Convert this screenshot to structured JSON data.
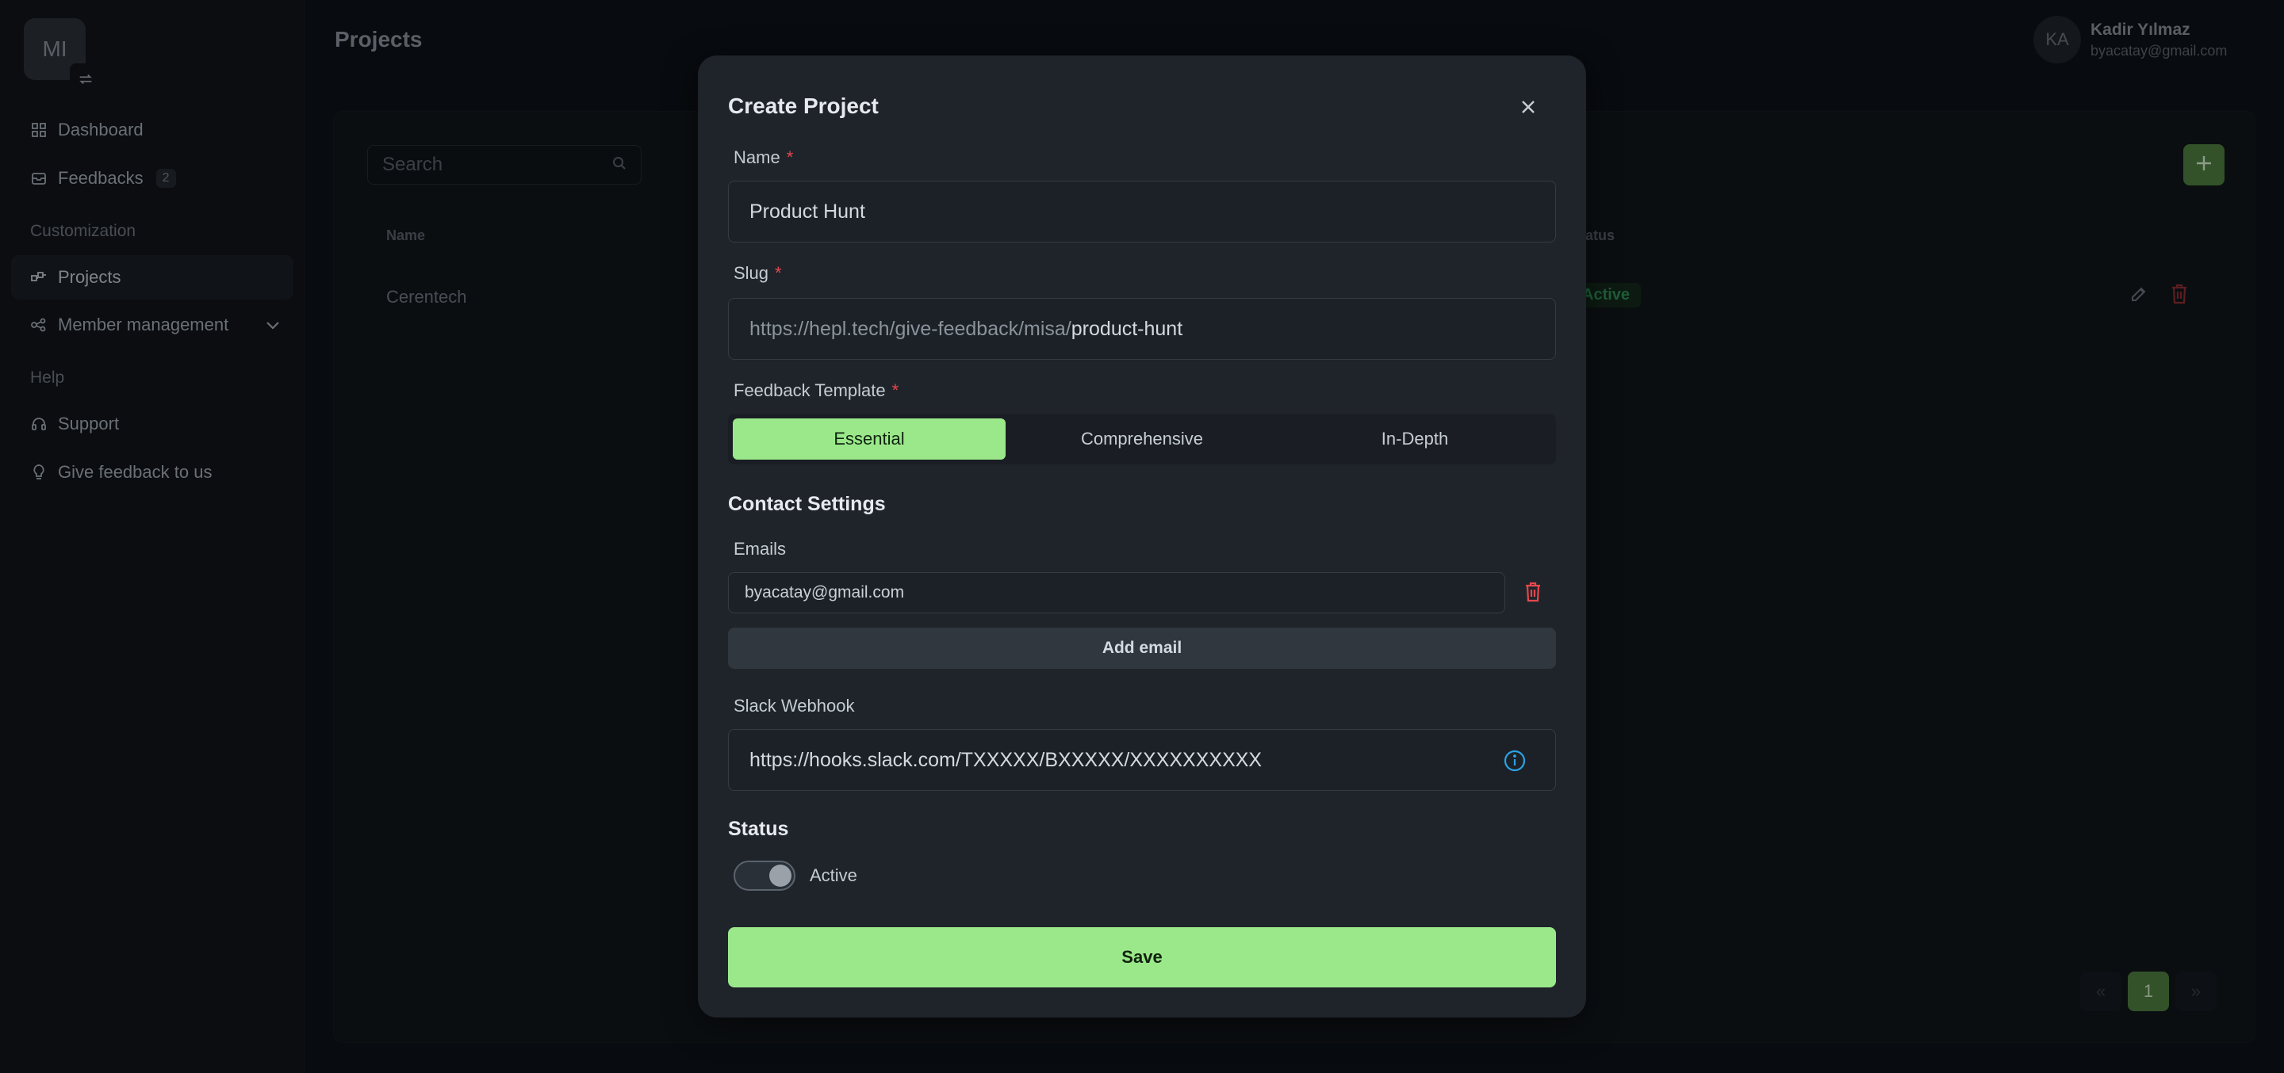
{
  "app": {
    "logo_text": "MI",
    "colors": {
      "accent": "#9ae88a",
      "accent_dark": "#4f7e3f",
      "danger": "#e5484d",
      "info": "#2aa3e6",
      "success": "#2f8f55"
    }
  },
  "sidebar": {
    "items": [
      {
        "label": "Dashboard",
        "icon": "grid-icon"
      },
      {
        "label": "Feedbacks",
        "icon": "inbox-icon",
        "badge": "2"
      }
    ],
    "sections": [
      {
        "title": "Customization",
        "items": [
          {
            "label": "Projects",
            "icon": "projects-icon",
            "active": true
          },
          {
            "label": "Member management",
            "icon": "members-icon",
            "expandable": true
          }
        ]
      },
      {
        "title": "Help",
        "items": [
          {
            "label": "Support",
            "icon": "headset-icon"
          },
          {
            "label": "Give feedback to us",
            "icon": "bulb-icon"
          }
        ]
      }
    ]
  },
  "header": {
    "title": "Projects",
    "user": {
      "initials": "KA",
      "name": "Kadir Yılmaz",
      "email": "byacatay@gmail.com"
    }
  },
  "main": {
    "search": {
      "placeholder": "Search"
    },
    "table": {
      "columns": [
        "Name",
        "Status"
      ],
      "rows": [
        {
          "name": "Cerentech",
          "status": "Active"
        }
      ]
    },
    "pagination": {
      "prev": "«",
      "current": "1",
      "next": "»"
    }
  },
  "modal": {
    "title": "Create Project",
    "name": {
      "label": "Name",
      "required": "*",
      "value": "Product Hunt"
    },
    "slug": {
      "label": "Slug",
      "required": "*",
      "prefix": "https://hepl.tech/give-feedback/misa/",
      "value": "product-hunt"
    },
    "template": {
      "label": "Feedback Template",
      "required": "*",
      "options": [
        "Essential",
        "Comprehensive",
        "In-Depth"
      ],
      "selected": "Essential"
    },
    "contact": {
      "title": "Contact Settings",
      "emails_label": "Emails",
      "emails": [
        "byacatay@gmail.com"
      ],
      "add_email_label": "Add email",
      "slack_label": "Slack Webhook",
      "slack_placeholder": "https://hooks.slack.com/TXXXXX/BXXXXX/XXXXXXXXXX"
    },
    "status": {
      "title": "Status",
      "toggle_label": "Active",
      "on": true
    },
    "save_label": "Save"
  }
}
